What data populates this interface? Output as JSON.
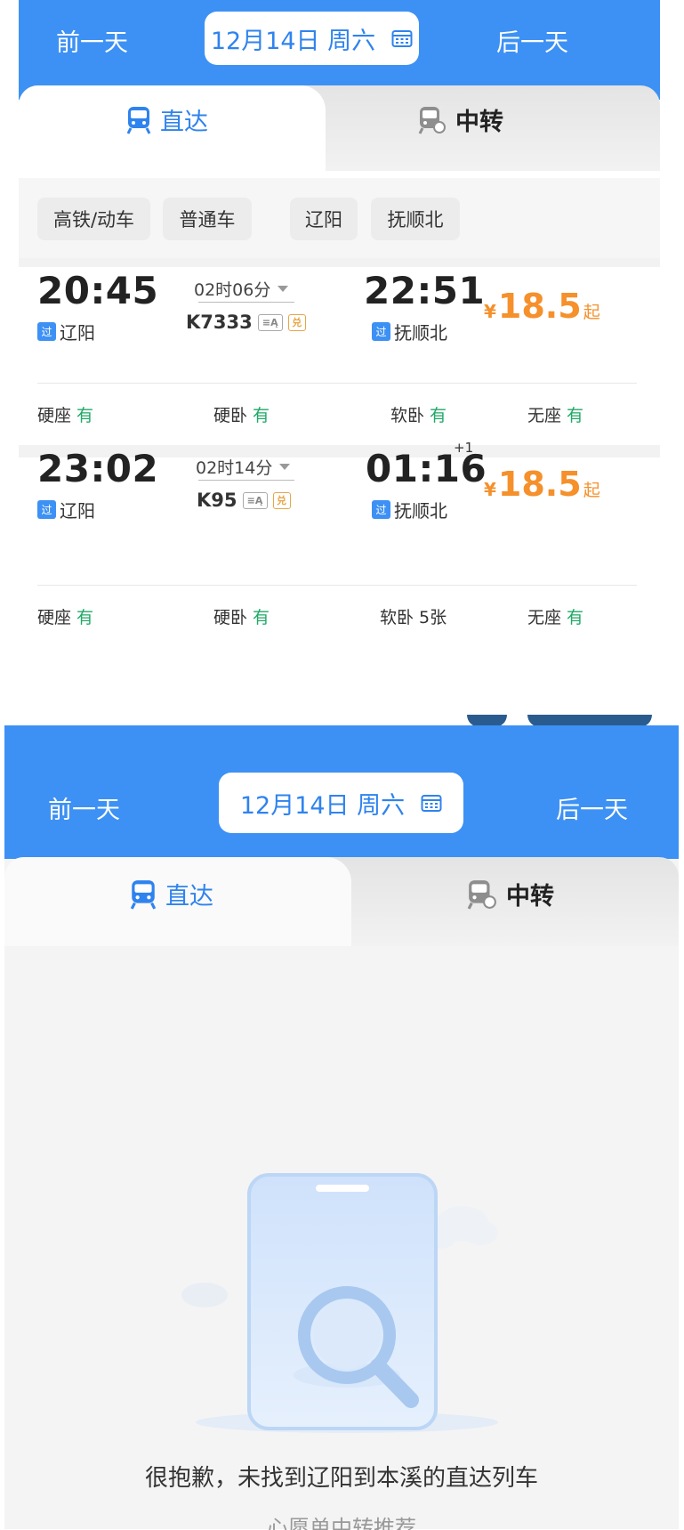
{
  "top": {
    "prev_day": "前一天",
    "next_day": "后一天",
    "date": "12月14日 周六",
    "tabs": {
      "direct": "直达",
      "transfer": "中转"
    },
    "filters": [
      "高铁/动车",
      "普通车",
      "辽阳",
      "抚顺北"
    ],
    "trains": [
      {
        "dep_time": "20:45",
        "dep_station": "辽阳",
        "dep_tag": "过",
        "duration": "02时06分",
        "train_no": "K7333",
        "arr_time": "22:51",
        "arr_station": "抚顺北",
        "arr_tag": "过",
        "day_offset": "",
        "price_symbol": "¥",
        "price": "18.5",
        "price_suffix": "起",
        "seats": [
          {
            "type": "硬座",
            "avail": "有"
          },
          {
            "type": "硬卧",
            "avail": "有"
          },
          {
            "type": "软卧",
            "avail": "有"
          },
          {
            "type": "无座",
            "avail": "有"
          }
        ]
      },
      {
        "dep_time": "23:02",
        "dep_station": "辽阳",
        "dep_tag": "过",
        "duration": "02时14分",
        "train_no": "K95",
        "arr_time": "01:16",
        "arr_station": "抚顺北",
        "arr_tag": "过",
        "day_offset": "+1",
        "price_symbol": "¥",
        "price": "18.5",
        "price_suffix": "起",
        "seats": [
          {
            "type": "硬座",
            "avail": "有"
          },
          {
            "type": "硬卧",
            "avail": "有"
          },
          {
            "type": "软卧",
            "avail": "5张"
          },
          {
            "type": "无座",
            "avail": "有"
          }
        ]
      }
    ]
  },
  "bottom": {
    "prev_day": "前一天",
    "next_day": "后一天",
    "date": "12月14日 周六",
    "tabs": {
      "direct": "直达",
      "transfer": "中转"
    },
    "empty_message": "很抱歉，未找到辽阳到本溪的直达列车",
    "cut_text": "心愿单中转推荐"
  },
  "colors": {
    "brand_blue": "#3d91f4",
    "price_orange": "#f5902b",
    "available_green": "#20a867"
  }
}
